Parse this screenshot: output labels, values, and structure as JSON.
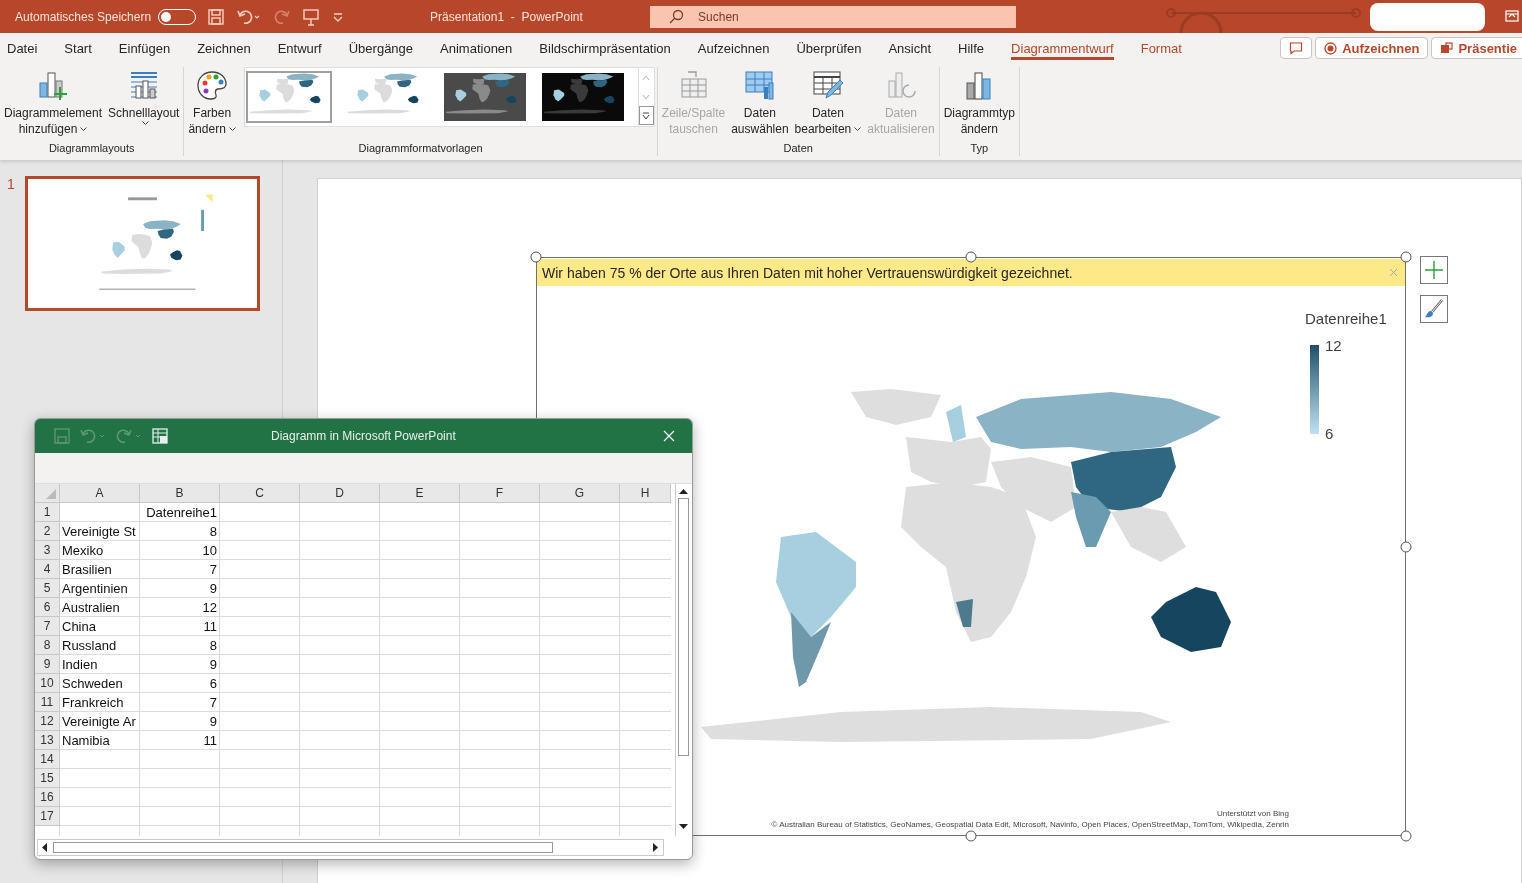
{
  "title_bar": {
    "autosave_label": "Automatisches Speichern",
    "autosave_on": false,
    "title": "Präsentation1  -  PowerPoint",
    "search_placeholder": "Suchen"
  },
  "menu_tabs": [
    {
      "label": "Datei",
      "selected": false,
      "kind": "normal"
    },
    {
      "label": "Start",
      "selected": false,
      "kind": "normal"
    },
    {
      "label": "Einfügen",
      "selected": false,
      "kind": "normal"
    },
    {
      "label": "Zeichnen",
      "selected": false,
      "kind": "normal"
    },
    {
      "label": "Entwurf",
      "selected": false,
      "kind": "normal"
    },
    {
      "label": "Übergänge",
      "selected": false,
      "kind": "normal"
    },
    {
      "label": "Animationen",
      "selected": false,
      "kind": "normal"
    },
    {
      "label": "Bildschirmpräsentation",
      "selected": false,
      "kind": "normal"
    },
    {
      "label": "Aufzeichnen",
      "selected": false,
      "kind": "normal"
    },
    {
      "label": "Überprüfen",
      "selected": false,
      "kind": "normal"
    },
    {
      "label": "Ansicht",
      "selected": false,
      "kind": "normal"
    },
    {
      "label": "Hilfe",
      "selected": false,
      "kind": "normal"
    },
    {
      "label": "Diagrammentwurf",
      "selected": true,
      "kind": "context"
    },
    {
      "label": "Format",
      "selected": false,
      "kind": "context"
    }
  ],
  "actions": [
    {
      "label": "Aufzeichnen",
      "kind": "record"
    },
    {
      "label": "Präsentie",
      "kind": "present"
    }
  ],
  "ribbon_groups": [
    {
      "label": "Diagrammlayouts",
      "buttons": [
        {
          "lines": [
            "Diagrammelement",
            "hinzufügen"
          ],
          "dropdown": true,
          "disabled": false,
          "kind": "add-element"
        },
        {
          "lines": [
            "Schnelllayout"
          ],
          "dropdown": true,
          "disabled": false,
          "kind": "quick-layout"
        }
      ]
    },
    {
      "label": "Diagrammformatvorlagen",
      "buttons": [
        {
          "lines": [
            "Farben",
            "ändern"
          ],
          "dropdown": true,
          "disabled": false,
          "kind": "colors"
        }
      ],
      "styles": [
        {
          "kind": "light",
          "selected": true
        },
        {
          "kind": "light",
          "selected": false
        },
        {
          "kind": "grey",
          "selected": false
        },
        {
          "kind": "black",
          "selected": false
        }
      ]
    },
    {
      "label": "Daten",
      "buttons": [
        {
          "lines": [
            "Zeile/Spalte",
            "tauschen"
          ],
          "dropdown": false,
          "disabled": true,
          "kind": "switch"
        },
        {
          "lines": [
            "Daten",
            "auswählen"
          ],
          "dropdown": false,
          "disabled": false,
          "kind": "select-data"
        },
        {
          "lines": [
            "Daten",
            "bearbeiten"
          ],
          "dropdown": true,
          "disabled": false,
          "kind": "edit-data"
        },
        {
          "lines": [
            "Daten",
            "aktualisieren"
          ],
          "dropdown": false,
          "disabled": true,
          "kind": "refresh"
        }
      ]
    },
    {
      "label": "Typ",
      "buttons": [
        {
          "lines": [
            "Diagrammtyp",
            "ändern"
          ],
          "dropdown": false,
          "disabled": false,
          "kind": "chart-type"
        }
      ]
    }
  ],
  "slides": [
    {
      "number": "1",
      "selected": true
    }
  ],
  "chart": {
    "banner": "Wir haben 75 % der Orte aus Ihren Daten mit hoher Vertrauenswürdigkeit gezeichnet.",
    "legend_title": "Datenreihe1",
    "legend_max": "12",
    "legend_min": "6",
    "credit": "Unterstützt von Bing",
    "attribution": "© Australian Bureau of Statistics, GeoNames, Geospatial Data Edit, Microsoft, Navinfo, Open Places, OpenStreetMap, TomTom, Wikipedia, Zenrin"
  },
  "sheet": {
    "title": "Diagramm in Microsoft PowerPoint",
    "columns": [
      "A",
      "B",
      "C",
      "D",
      "E",
      "F",
      "G",
      "H"
    ],
    "rows": [
      {
        "number": "1",
        "value": "Datenreihe1"
      },
      {
        "number": "2",
        "label": "Vereinigte St",
        "value": "8"
      },
      {
        "number": "3",
        "label": "Mexiko",
        "value": "10"
      },
      {
        "number": "4",
        "label": "Brasilien",
        "value": "7"
      },
      {
        "number": "5",
        "label": "Argentinien",
        "value": "9"
      },
      {
        "number": "6",
        "label": "Australien",
        "value": "12"
      },
      {
        "number": "7",
        "label": "China",
        "value": "11"
      },
      {
        "number": "8",
        "label": "Russland",
        "value": "8"
      },
      {
        "number": "9",
        "label": "Indien",
        "value": "9"
      },
      {
        "number": "10",
        "label": "Schweden",
        "value": "6"
      },
      {
        "number": "11",
        "label": "Frankreich",
        "value": "7"
      },
      {
        "number": "12",
        "label": "Vereinigte Ar",
        "value": "9"
      },
      {
        "number": "13",
        "label": "Namibia",
        "value": "11"
      },
      {
        "number": "14"
      },
      {
        "number": "15"
      },
      {
        "number": "16"
      },
      {
        "number": "17"
      }
    ]
  }
}
